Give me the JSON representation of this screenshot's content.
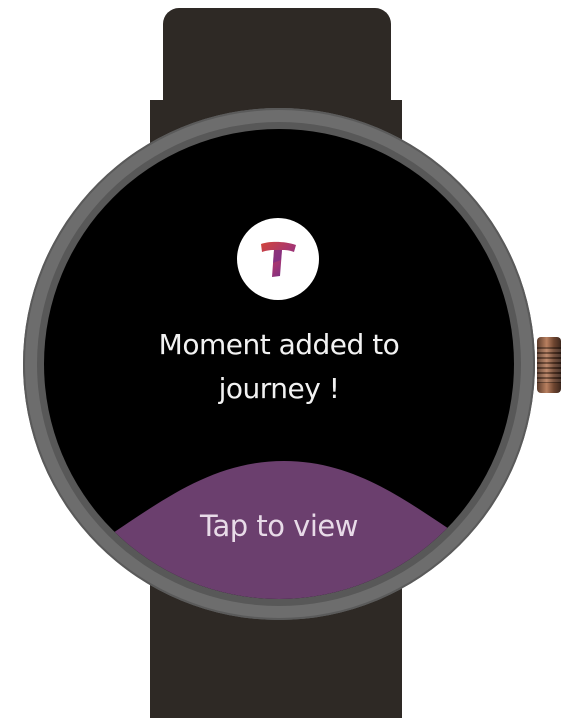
{
  "notification": {
    "app_icon": "journey-t-logo-icon",
    "message_line1": "Moment added to",
    "message_line2": "journey !",
    "action_label": "Tap to view"
  },
  "colors": {
    "screen_background": "#000000",
    "action_background": "#6b3f6e",
    "strap": "#2e2925",
    "case": "#6d6d6d",
    "logo_primary": "#c0392b",
    "logo_secondary": "#6a2c91"
  }
}
